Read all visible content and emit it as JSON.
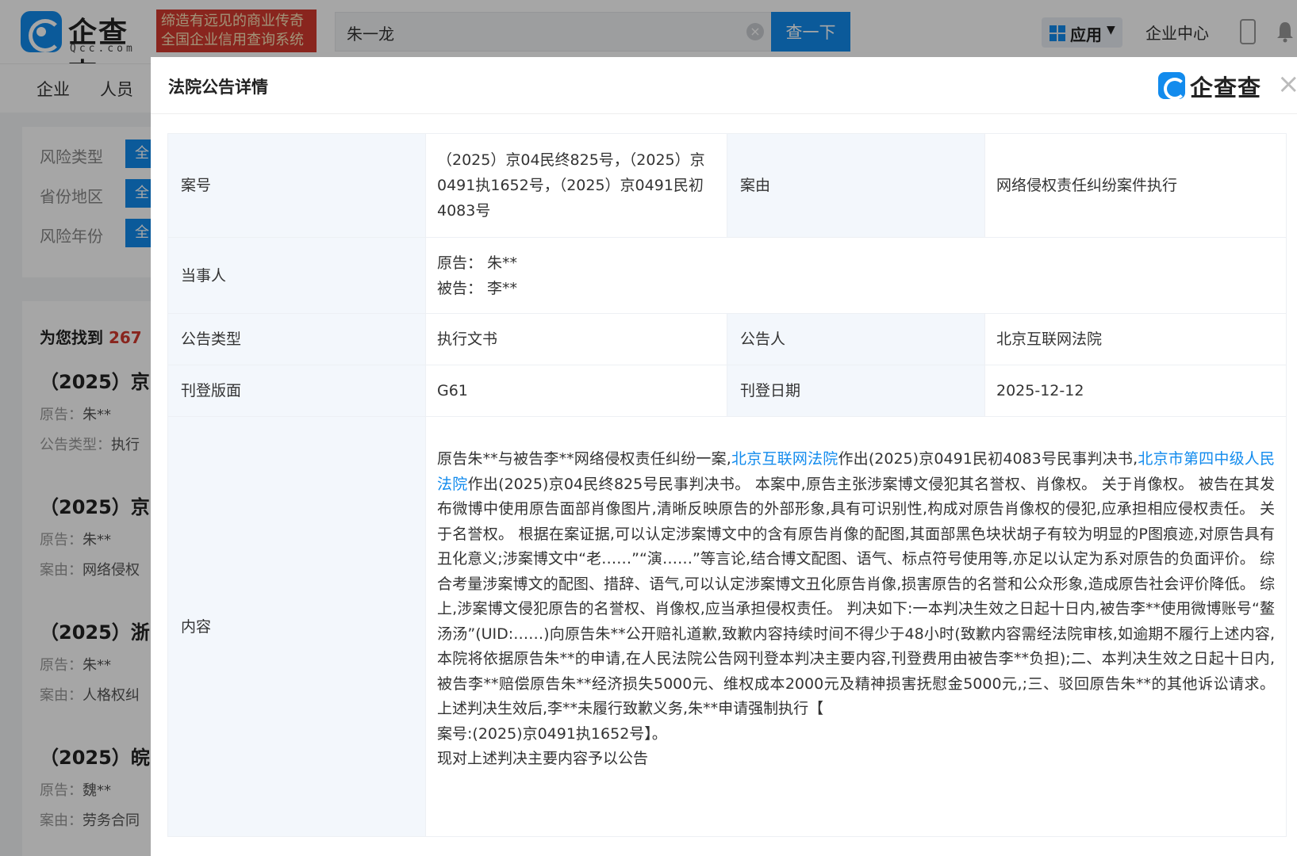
{
  "header": {
    "logo_text": "企查查",
    "logo_sub": "Qcc.com",
    "slogan_line1": "缔造有远见的商业传奇",
    "slogan_line2": "全国企业信用查询系统",
    "search_value": "朱一龙",
    "search_button": "查一下",
    "apps_label": "应用",
    "enterprise_center": "企业中心"
  },
  "nav": {
    "items": [
      "企业",
      "人员"
    ]
  },
  "filters": [
    {
      "label": "风险类型",
      "value": "全"
    },
    {
      "label": "省份地区",
      "value": "全"
    },
    {
      "label": "风险年份",
      "value": "全"
    }
  ],
  "results": {
    "found_prefix": "为您找到",
    "found_count": "267",
    "items": [
      {
        "title": "（2025）京",
        "line1_label": "原告：",
        "line1_value": "朱**",
        "line2_label": "公告类型：",
        "line2_value": "执行"
      },
      {
        "title": "（2025）京",
        "line1_label": "原告：",
        "line1_value": "朱**",
        "line2_label": "案由：",
        "line2_value": "网络侵权"
      },
      {
        "title": "（2025）浙",
        "line1_label": "原告：",
        "line1_value": "朱**",
        "line2_label": "案由：",
        "line2_value": "人格权纠"
      },
      {
        "title": "（2025）皖",
        "line1_label": "原告：",
        "line1_value": "魏**",
        "line2_label": "案由：",
        "line2_value": "劳务合同"
      }
    ]
  },
  "modal": {
    "title": "法院公告详情",
    "logo_text": "企查查",
    "fields": {
      "case_no_label": "案号",
      "case_no_value": "（2025）京04民终825号，（2025）京0491执1652号，（2025）京0491民初4083号",
      "cause_label": "案由",
      "cause_value": "网络侵权责任纠纷案件执行",
      "parties_label": "当事人",
      "plaintiff": "原告：  朱**",
      "defendant": "被告：  李**",
      "notice_type_label": "公告类型",
      "notice_type_value": "执行文书",
      "announcer_label": "公告人",
      "announcer_value": "北京互联网法院",
      "layout_label": "刊登版面",
      "layout_value": "G61",
      "date_label": "刊登日期",
      "date_value": "2025-12-12",
      "content_label": "内容"
    },
    "content": {
      "part1": "原告朱**与被告李**网络侵权责任纠纷一案,",
      "link1": "北京互联网法院",
      "part2": "作出(2025)京0491民初4083号民事判决书,",
      "link2": "北京市第四中级人民法院",
      "part3": "作出(2025)京04民终825号民事判决书。 本案中,原告主张涉案博文侵犯其名誉权、肖像权。 关于肖像权。 被告在其发布微博中使用原告面部肖像图片,清晰反映原告的外部形象,具有可识别性,构成对原告肖像权的侵犯,应承担相应侵权责任。 关于名誉权。 根据在案证据,可以认定涉案博文中的含有原告肖像的配图,其面部黑色块状胡子有较为明显的P图痕迹,对原告具有丑化意义;涉案博文中“老……”“演……”等言论,结合博文配图、语气、标点符号使用等,亦足以认定为系对原告的负面评价。 综合考量涉案博文的配图、措辞、语气,可以认定涉案博文丑化原告肖像,损害原告的名誉和公众形象,造成原告社会评价降低。 综上,涉案博文侵犯原告的名誉权、肖像权,应当承担侵权责任。 判决如下:一本判决生效之日起十日内,被告李**使用微博账号“鳌汤汤”(UID:……)向原告朱**公开赔礼道歉,致歉内容持续时间不得少于48小时(致歉内容需经法院审核,如逾期不履行上述内容,本院将依据原告朱**的申请,在人民法院公告网刊登本判决主要内容,刊登费用由被告李**负担);二、本判决生效之日起十日内,被告李**赔偿原告朱**经济损失5000元、维权成本2000元及精神损害抚慰金5000元,;三、驳回原告朱**的其他诉讼请求。 上述判决生效后,李**未履行致歉义务,朱**申请强制执行【",
      "line_case": "案号:(2025)京0491执1652号】。",
      "line_last": "现对上述判决主要内容予以公告"
    }
  },
  "colors": {
    "brand": "#128bed",
    "slogan_bg": "#d33a2e",
    "label_bg": "#f3f7fc"
  }
}
